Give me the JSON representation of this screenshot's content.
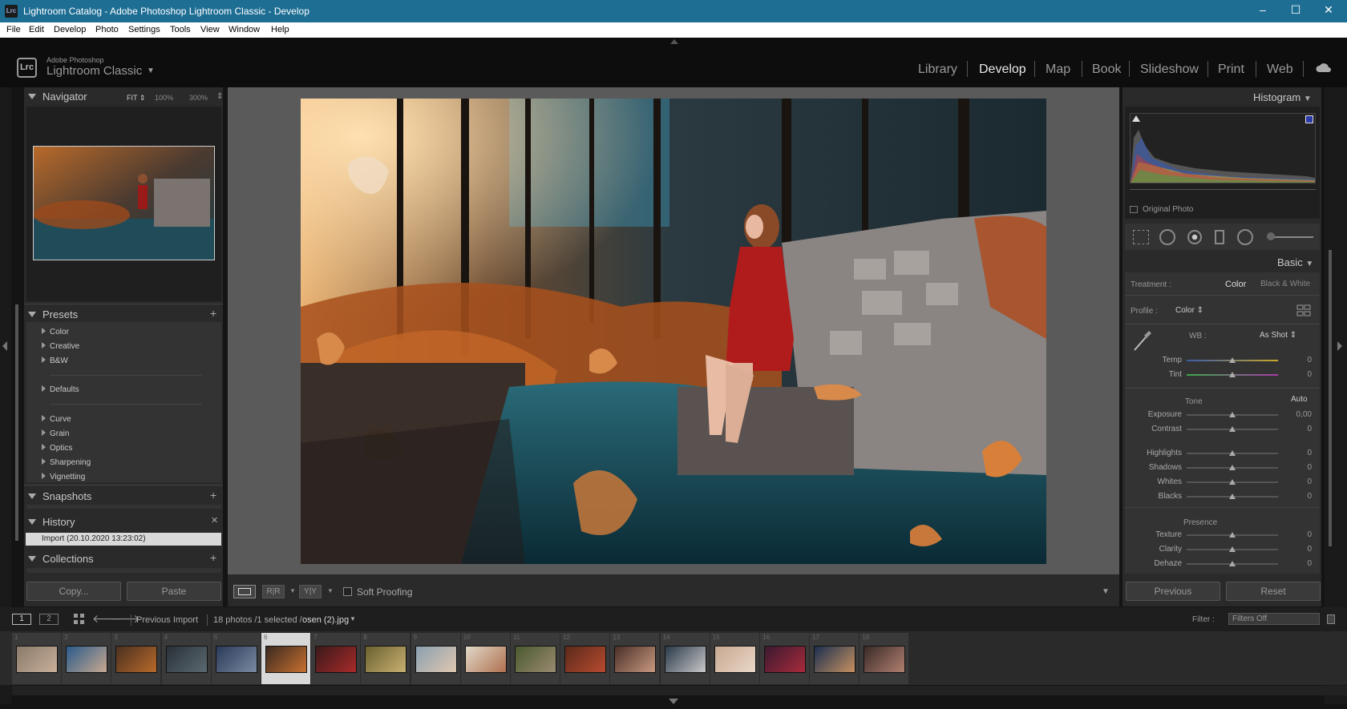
{
  "window": {
    "title": "Lightroom Catalog - Adobe Photoshop Lightroom Classic - Develop",
    "app_icon": "Lrc",
    "minimize": "–",
    "maximize": "☐",
    "close": "✕"
  },
  "menu": [
    "File",
    "Edit",
    "Develop",
    "Photo",
    "Settings",
    "Tools",
    "View",
    "Window",
    "Help"
  ],
  "identity": {
    "logo": "Lrc",
    "brand_top": "Adobe Photoshop",
    "brand_name": "Lightroom Classic"
  },
  "modules": [
    "Library",
    "Develop",
    "Map",
    "Book",
    "Slideshow",
    "Print",
    "Web"
  ],
  "active_module": "Develop",
  "navigator": {
    "title": "Navigator",
    "zoom_fit": "FIT ⇕",
    "zoom_100": "100%",
    "zoom_300": "300%"
  },
  "presets": {
    "title": "Presets",
    "groups": [
      "Color",
      "Creative",
      "B&W",
      "Defaults",
      "Curve",
      "Grain",
      "Optics",
      "Sharpening",
      "Vignetting"
    ]
  },
  "snapshots": {
    "title": "Snapshots"
  },
  "history": {
    "title": "History",
    "item": "Import (20.10.2020 13:23:02)"
  },
  "collections": {
    "title": "Collections"
  },
  "left_buttons": {
    "copy": "Copy...",
    "paste": "Paste"
  },
  "toolbar": {
    "soft_proofing": "Soft Proofing",
    "before_after_1": "R|R",
    "before_after_2": "Y|Y"
  },
  "histogram": {
    "title": "Histogram",
    "original_photo": "Original Photo"
  },
  "basic": {
    "title": "Basic",
    "treatment_label": "Treatment :",
    "treatment_color": "Color",
    "treatment_bw": "Black & White",
    "profile_label": "Profile :",
    "profile_value": "Color ⇕",
    "wb_label": "WB :",
    "wb_value": "As Shot ⇕",
    "tone_label": "Tone",
    "auto": "Auto",
    "presence_label": "Presence",
    "sliders": [
      {
        "name": "Temp",
        "value": "0",
        "pos": 0.5
      },
      {
        "name": "Tint",
        "value": "0",
        "pos": 0.5
      },
      {
        "name": "Exposure",
        "value": "0,00",
        "pos": 0.5
      },
      {
        "name": "Contrast",
        "value": "0",
        "pos": 0.5
      },
      {
        "name": "Highlights",
        "value": "0",
        "pos": 0.5
      },
      {
        "name": "Shadows",
        "value": "0",
        "pos": 0.5
      },
      {
        "name": "Whites",
        "value": "0",
        "pos": 0.5
      },
      {
        "name": "Blacks",
        "value": "0",
        "pos": 0.5
      },
      {
        "name": "Texture",
        "value": "0",
        "pos": 0.5
      },
      {
        "name": "Clarity",
        "value": "0",
        "pos": 0.5
      },
      {
        "name": "Dehaze",
        "value": "0",
        "pos": 0.5
      }
    ]
  },
  "right_buttons": {
    "previous": "Previous",
    "reset": "Reset"
  },
  "filmstrip_bar": {
    "screen1": "1",
    "screen2": "2",
    "source": "Previous Import",
    "count": "18 photos /1 selected /",
    "filename": "osen (2).jpg",
    "filter_label": "Filter :",
    "filter_value": "Filters Off"
  },
  "thumbnails": [
    "1",
    "2",
    "3",
    "4",
    "5",
    "6",
    "7",
    "8",
    "9",
    "10",
    "11",
    "12",
    "13",
    "14",
    "15",
    "16",
    "17",
    "18"
  ],
  "colors": {
    "accent_title": "#1e6e94",
    "panel": "#2a2a2a",
    "bg": "#141414"
  }
}
